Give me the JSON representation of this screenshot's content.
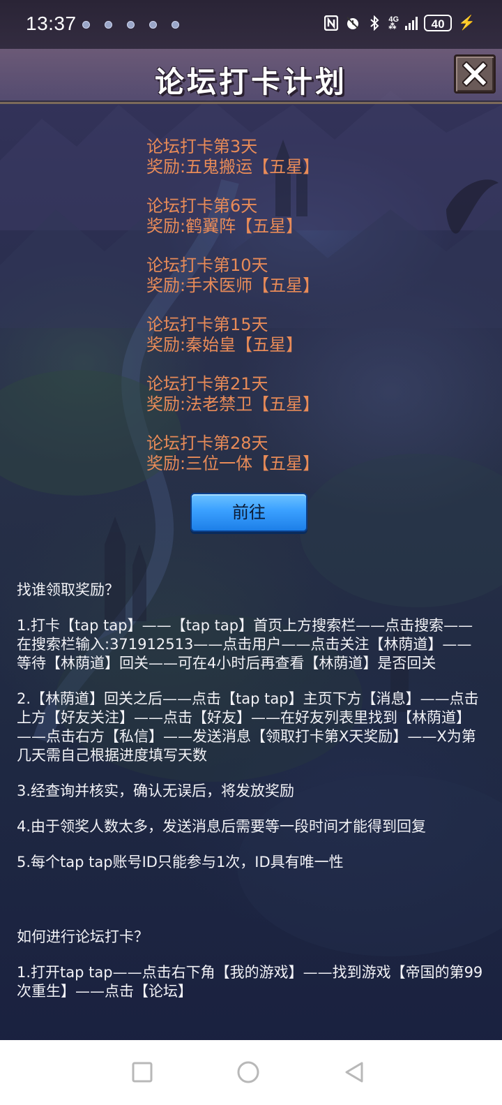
{
  "status_bar": {
    "time": "13:37",
    "network": "4G",
    "battery": "40",
    "icons": [
      "nfc-icon",
      "alarm-icon",
      "bluetooth-icon",
      "signal-icon",
      "battery-icon",
      "charging-icon"
    ]
  },
  "header": {
    "title": "论坛打卡计划",
    "close_icon": "close-icon"
  },
  "rewards": [
    {
      "day": "论坛打卡第3天",
      "prize": "奖励:五鬼搬运【五星】"
    },
    {
      "day": "论坛打卡第6天",
      "prize": "奖励:鹤翼阵【五星】"
    },
    {
      "day": "论坛打卡第10天",
      "prize": "奖励:手术医师【五星】"
    },
    {
      "day": "论坛打卡第15天",
      "prize": "奖励:秦始皇【五星】"
    },
    {
      "day": "论坛打卡第21天",
      "prize": "奖励:法老禁卫【五星】"
    },
    {
      "day": "论坛打卡第28天",
      "prize": "奖励:三位一体【五星】"
    }
  ],
  "go_button": "前往",
  "instructions": {
    "claim_heading": "找谁领取奖励？",
    "claim_steps": [
      "1.打卡【tap tap】——【tap tap】首页上方搜索栏——点击搜索——在搜索栏输入:371912513——点击用户——点击关注【林荫道】——等待【林荫道】回关——可在4小时后再查看【林荫道】是否回关",
      "2.【林荫道】回关之后——点击【tap tap】主页下方【消息】——点击上方【好友关注】——点击【好友】——在好友列表里找到【林荫道】——点击右方【私信】——发送消息【领取打卡第X天奖励】——X为第几天需自己根据进度填写天数",
      "3.经查询并核实，确认无误后，将发放奖励",
      "4.由于领奖人数太多，发送消息后需要等一段时间才能得到回复",
      "5.每个tap tap账号ID只能参与1次，ID具有唯一性"
    ],
    "checkin_heading": "如何进行论坛打卡？",
    "checkin_steps": [
      "1.打开tap tap——点击右下角【我的游戏】——找到游戏【帝国的第99次重生】——点击【论坛】"
    ]
  },
  "colors": {
    "reward_text": "#e88b58",
    "button_blue": "#3aa0ff",
    "body_text": "#f2f2f6"
  },
  "nav_bar": {
    "icons": [
      "recent-apps-icon",
      "home-icon",
      "back-icon"
    ]
  }
}
